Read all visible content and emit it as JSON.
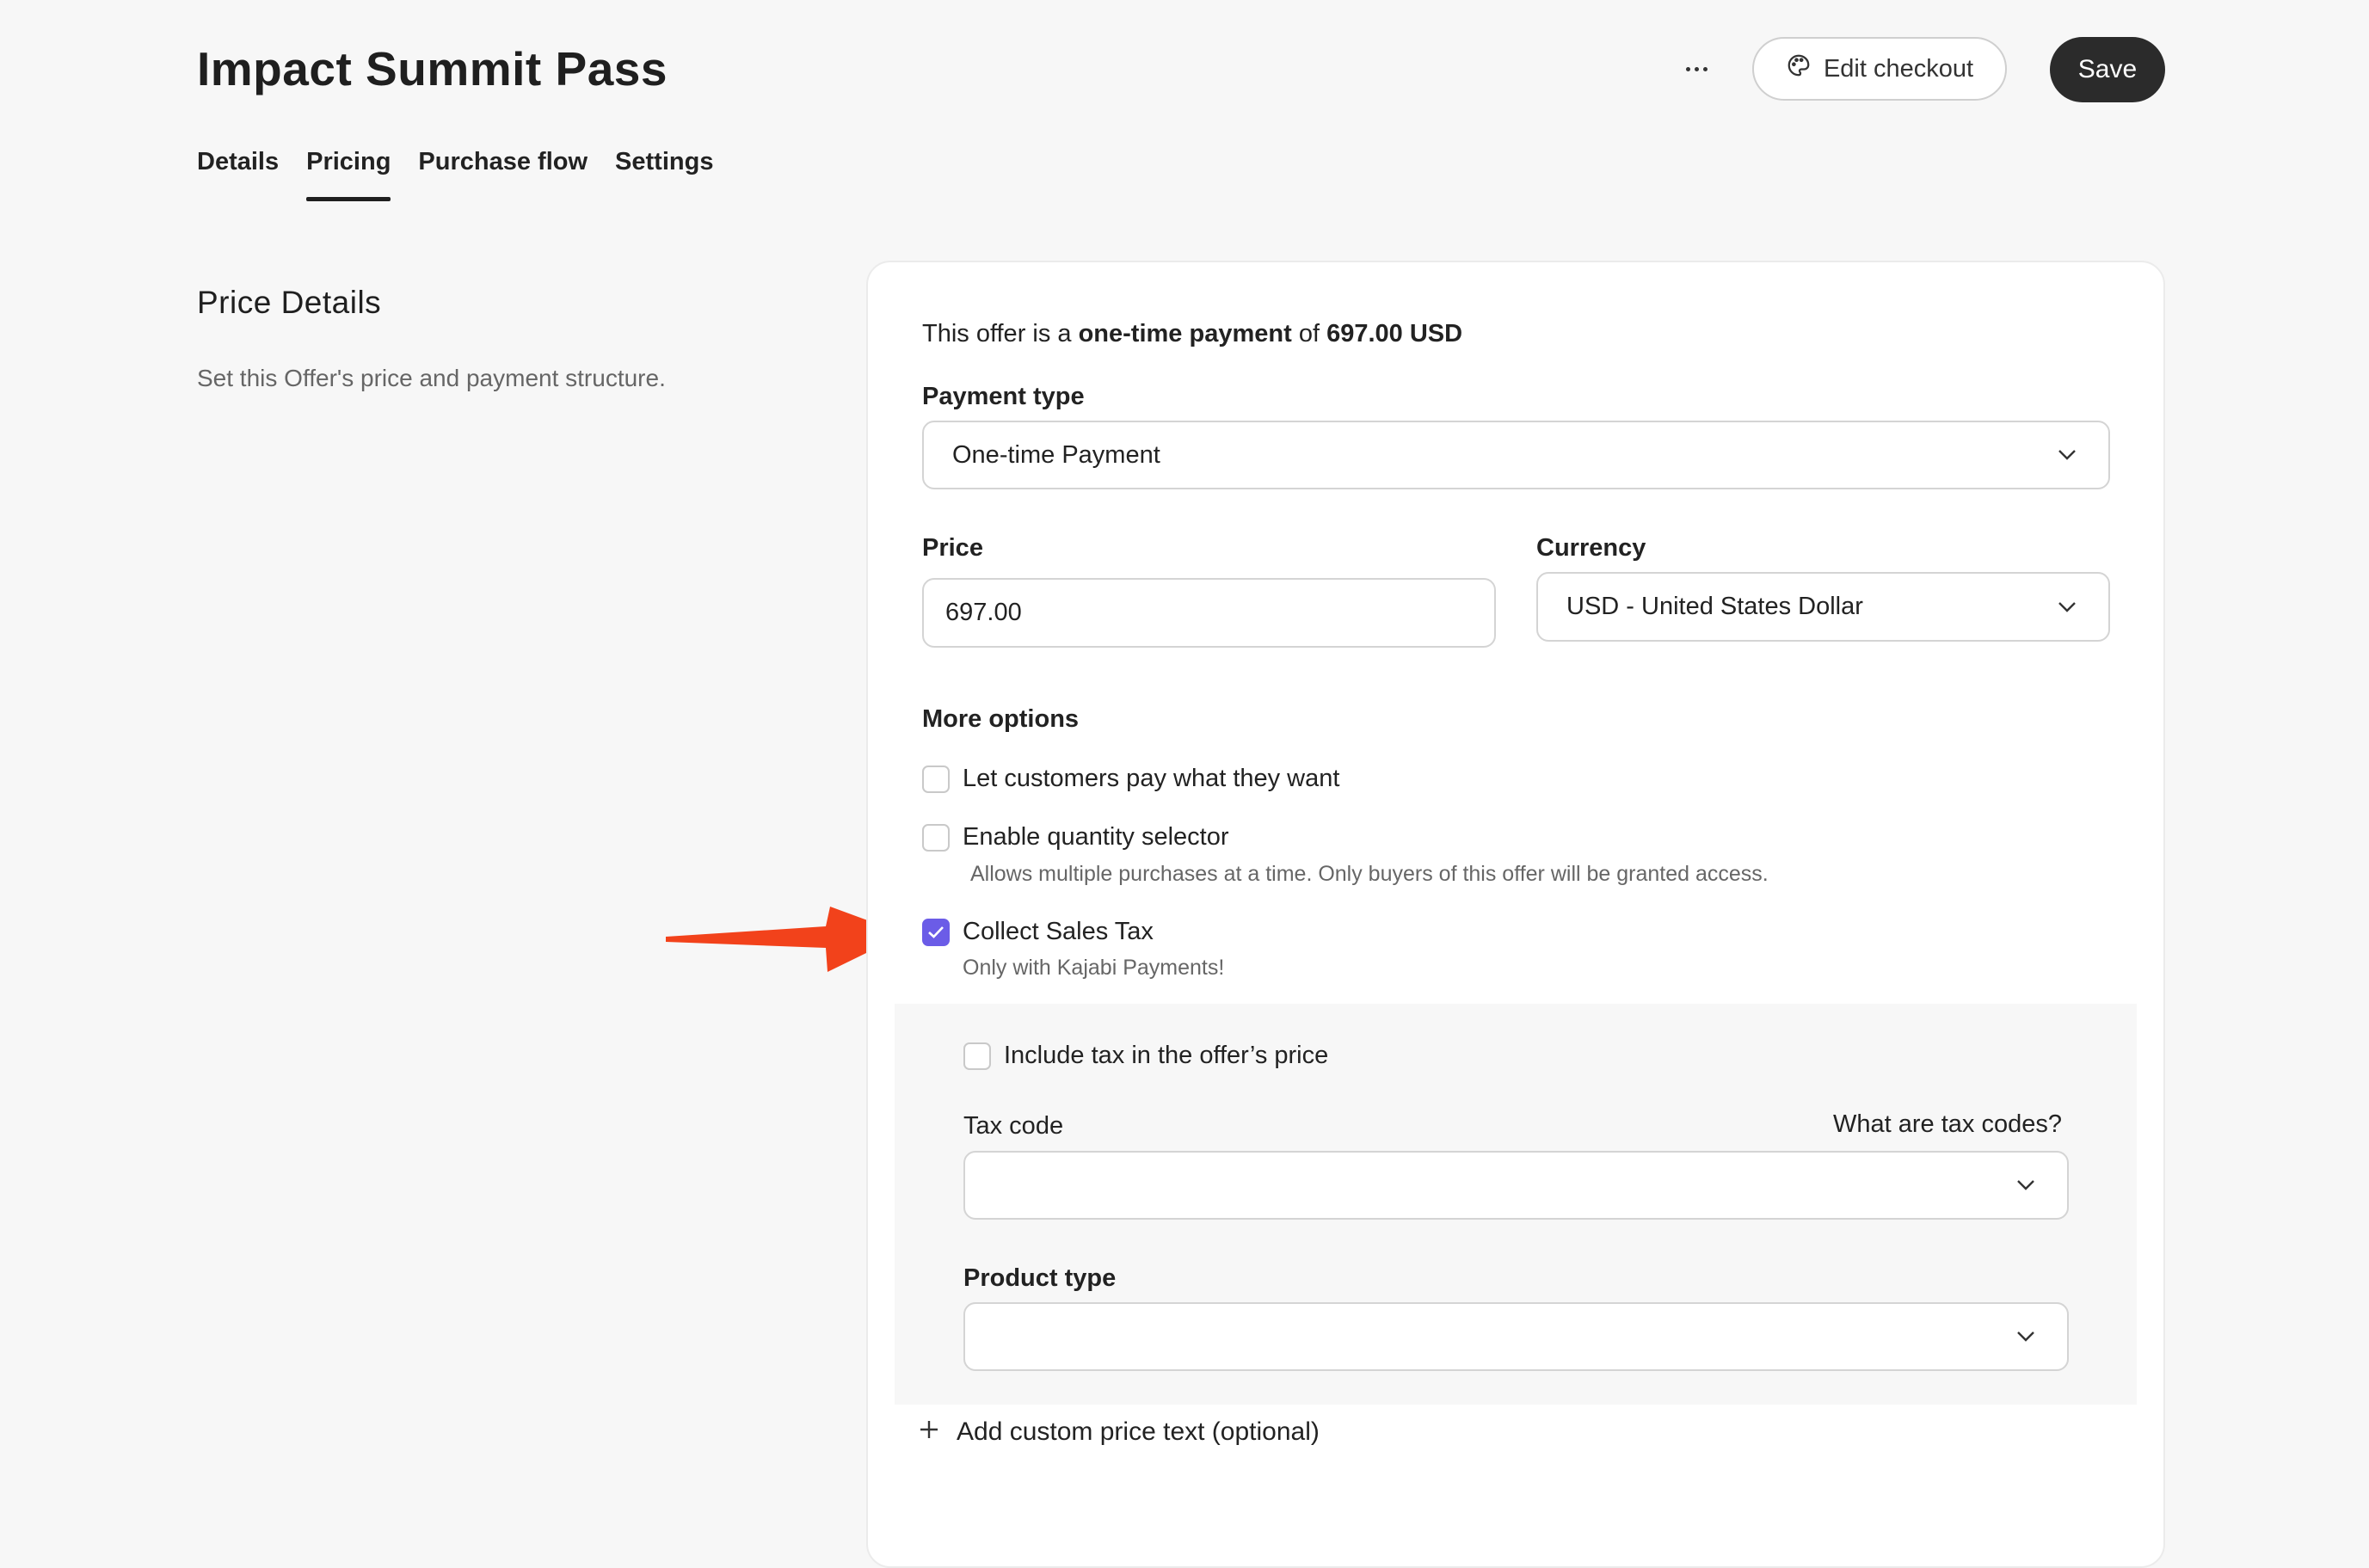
{
  "header": {
    "title": "Impact Summit Pass",
    "more_icon": "more-horizontal-icon",
    "edit_checkout_label": "Edit checkout",
    "edit_checkout_icon": "palette-icon",
    "save_label": "Save"
  },
  "tabs": [
    {
      "label": "Details",
      "active": false
    },
    {
      "label": "Pricing",
      "active": true
    },
    {
      "label": "Purchase flow",
      "active": false
    },
    {
      "label": "Settings",
      "active": false
    }
  ],
  "section": {
    "title": "Price Details",
    "description": "Set this Offer's price and payment structure."
  },
  "summary": {
    "prefix": "This offer is a ",
    "payment_kind": "one-time payment",
    "middle": " of ",
    "amount": "697.00 USD"
  },
  "payment_type": {
    "label": "Payment type",
    "value": "One-time Payment"
  },
  "price": {
    "label": "Price",
    "value": "697.00"
  },
  "currency": {
    "label": "Currency",
    "value": "USD - United States Dollar"
  },
  "more_options": {
    "label": "More options",
    "pay_what_they_want": {
      "label": "Let customers pay what they want",
      "checked": false
    },
    "quantity_selector": {
      "label": "Enable quantity selector",
      "checked": false,
      "helper": "Allows multiple purchases at a time. Only buyers of this offer will be granted access."
    },
    "collect_sales_tax": {
      "label": "Collect Sales Tax",
      "checked": true,
      "helper": "Only with Kajabi Payments!"
    }
  },
  "tax": {
    "include_tax": {
      "label": "Include tax in the offer’s price",
      "checked": false
    },
    "tax_code_label": "Tax code",
    "tax_code_help_link": "What are tax codes?",
    "tax_code_value": "",
    "product_type_label": "Product type",
    "product_type_value": ""
  },
  "custom_price_text": {
    "label": "Add custom price text (optional)",
    "icon": "plus-icon"
  },
  "annotation": {
    "arrow_icon": "arrow-right-icon",
    "arrow_color": "#f2421b"
  },
  "colors": {
    "accent_checkbox": "#6b5ce7",
    "save_button": "#2b2b2b",
    "background": "#f7f7f7"
  }
}
